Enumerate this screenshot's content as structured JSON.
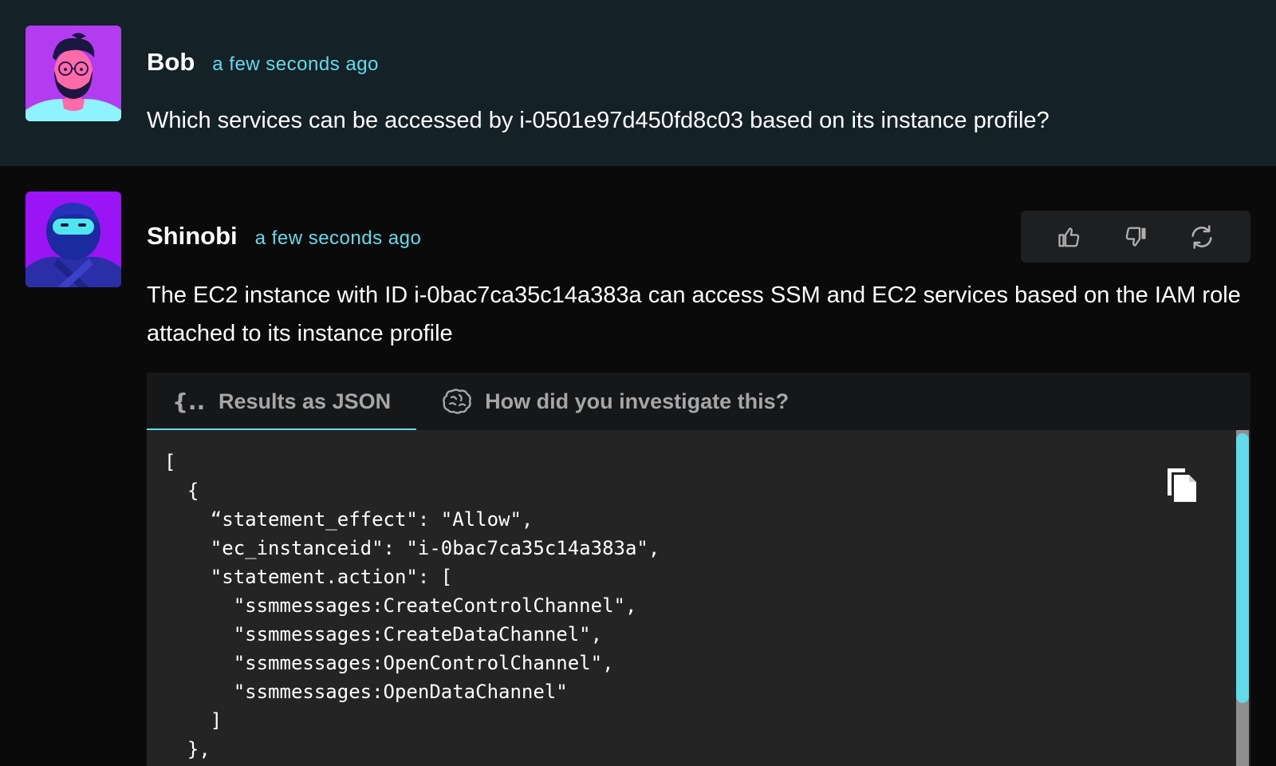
{
  "messages": {
    "user": {
      "author": "Bob",
      "time": "a few seconds ago",
      "text": "Which services can be accessed by i-0501e97d450fd8c03 based on its instance profile?"
    },
    "bot": {
      "author": "Shinobi",
      "time": "a few seconds ago",
      "text": "The EC2 instance with ID i-0bac7ca35c14a383a can access SSM and EC2 services based on the IAM role attached to its instance profile"
    }
  },
  "feedback": {
    "icons": [
      "thumbs-up-icon",
      "thumbs-down-icon",
      "refresh-icon"
    ]
  },
  "results": {
    "tabs": [
      {
        "label": "Results as JSON",
        "icon": "json-braces-icon",
        "active": true
      },
      {
        "label": "How did you investigate this?",
        "icon": "brain-icon",
        "active": false
      }
    ],
    "json_text": "[\n  {\n    “statement_effect\": \"Allow\",\n    \"ec_instanceid\": \"i-0bac7ca35c14a383a\",\n    \"statement.action\": [\n      \"ssmmessages:CreateControlChannel\",\n      \"ssmmessages:CreateDataChannel\",\n      \"ssmmessages:OpenControlChannel\",\n      \"ssmmessages:OpenDataChannel\"\n    ]\n  },"
  },
  "colors": {
    "accent": "#62dbe9",
    "user_bg": "#142127",
    "bot_bg": "#0a0a0a"
  }
}
